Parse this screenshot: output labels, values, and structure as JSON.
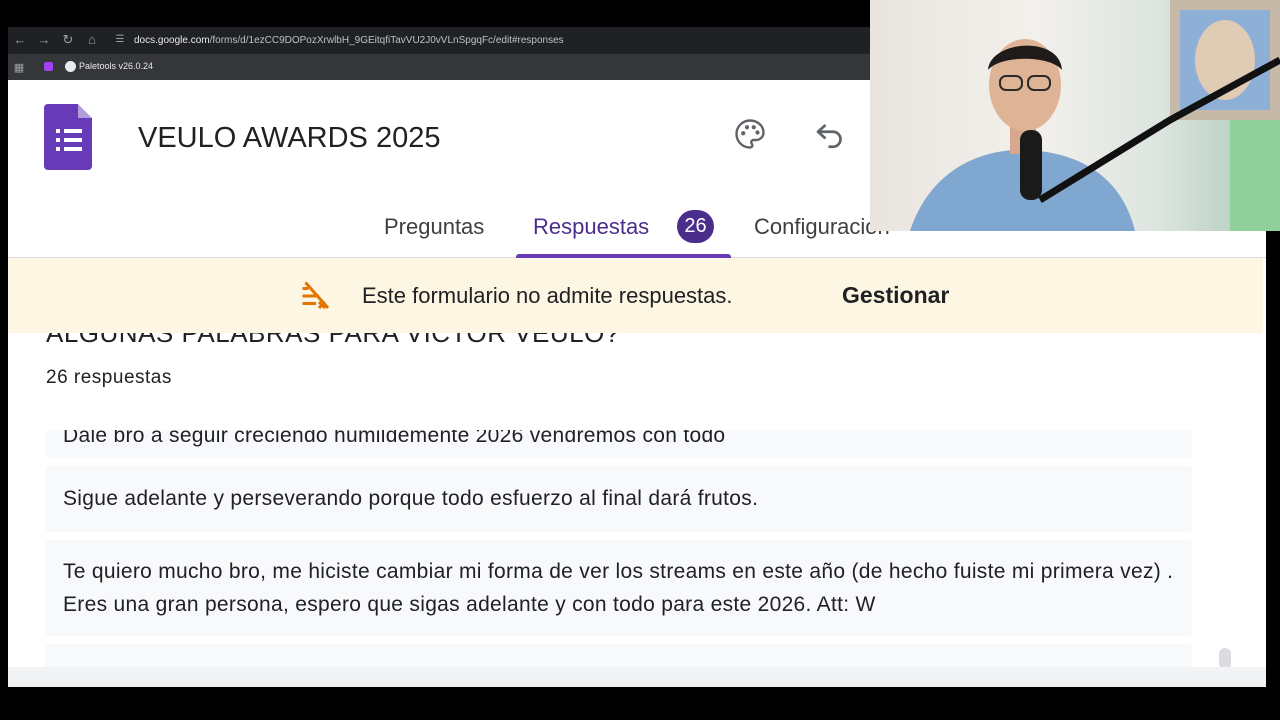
{
  "browser": {
    "url_domain": "docs.google.com",
    "url_path": "/forms/d/1ezCC9DOPozXrwlbH_9GEitqfiTavVU2J0vVLnSpgqFc/edit#responses",
    "bookmark_label": "Paletools v26.0.24"
  },
  "form": {
    "title": "VEULO AWARDS 2025"
  },
  "tabs": [
    {
      "label": "Preguntas"
    },
    {
      "label": "Respuestas",
      "badge": "26"
    },
    {
      "label": "Configuración"
    }
  ],
  "banner": {
    "message": "Este formulario no admite respuestas.",
    "action_label": "Gestionar"
  },
  "question": {
    "title": "ALGUNAS PALABRAS PARA VICTOR VEULO?",
    "response_count": "26 respuestas"
  },
  "responses": [
    {
      "text": "Dale bro a seguir creciendo humildemente 2026 vendremos con todo"
    },
    {
      "text": "Sigue adelante y perseverando porque todo esfuerzo al final dará frutos."
    },
    {
      "text": "Te quiero mucho bro, me hiciste cambiar mi forma de ver los streams en este año (de hecho fuiste mi primera vez) . Eres una gran persona, espero que sigas adelante y con todo para este 2026. Att: W"
    }
  ],
  "colors": {
    "accent": "#673ab7",
    "accent_dark": "#4b2e8c",
    "banner_bg": "#fdf6e3"
  },
  "icons": {
    "forms_logo": "google-forms-icon",
    "palette": "palette-icon",
    "undo": "undo-icon",
    "banner": "responses-off-icon"
  }
}
